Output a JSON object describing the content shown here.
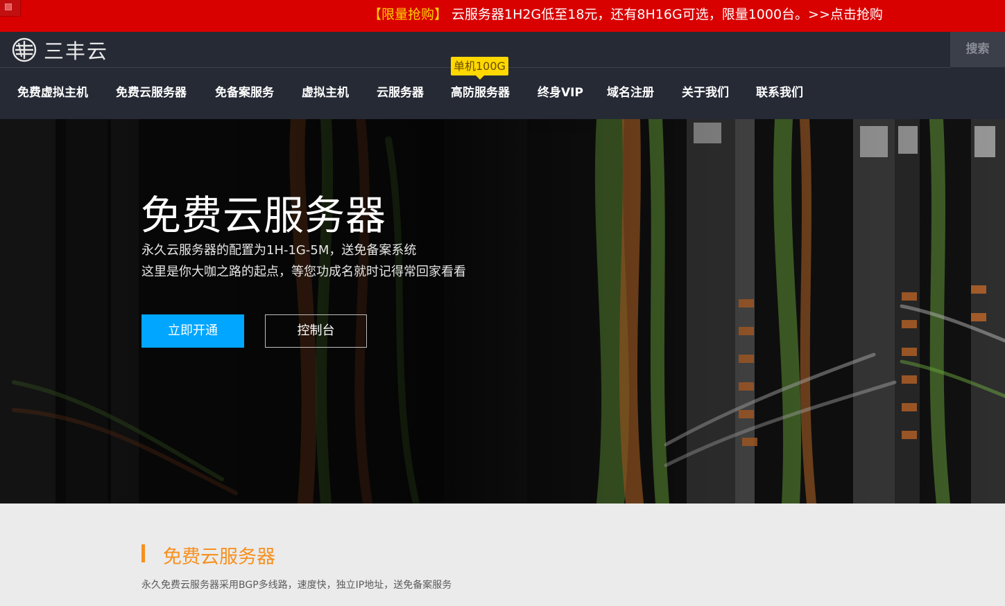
{
  "promo": {
    "tag": "【限量抢购】",
    "text": " 云服务器1H2G低至18元，还有8H16G可选，限量1000台。>>点击抢购"
  },
  "header": {
    "logo_text": "三丰云",
    "search_label": "搜索",
    "nav": [
      {
        "label": "免费虚拟主机"
      },
      {
        "label": "免费云服务器"
      },
      {
        "label": "免备案服务"
      },
      {
        "label": "虚拟主机"
      },
      {
        "label": "云服务器"
      },
      {
        "label": "高防服务器"
      },
      {
        "label": "终身VIP"
      },
      {
        "label": "域名注册"
      },
      {
        "label": "关于我们"
      },
      {
        "label": "联系我们"
      }
    ],
    "nav_badge": "单机100G"
  },
  "hero": {
    "title": "免费云服务器",
    "subtitle_1": "永久云服务器的配置为1H-1G-5M，送免备案系统",
    "subtitle_2": "这里是你大咖之路的起点，等您功成名就时记得常回家看看",
    "primary_button": "立即开通",
    "secondary_button": "控制台"
  },
  "section": {
    "title": "免费云服务器",
    "description": "永久免费云服务器采用BGP多线路，速度快，独立IP地址，送免备案服务"
  },
  "colors": {
    "promo_bg": "#d90000",
    "promo_tag": "#ffd200",
    "header_bg": "#262a35",
    "accent_blue": "#00a6ff",
    "accent_orange": "#f6901e",
    "badge_yellow": "#ffd800"
  }
}
